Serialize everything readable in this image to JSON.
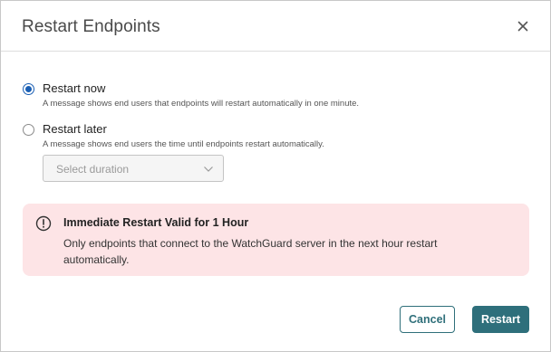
{
  "dialog": {
    "title": "Restart Endpoints",
    "close_icon": "close-icon"
  },
  "options": [
    {
      "label": "Restart now",
      "description": "A message shows end users that endpoints will restart automatically in one minute.",
      "checked": true
    },
    {
      "label": "Restart later",
      "description": "A message shows end users the time until endpoints restart automatically.",
      "checked": false
    }
  ],
  "duration_select": {
    "placeholder": "Select duration",
    "icon": "chevron-down-icon",
    "disabled": true
  },
  "alert": {
    "icon": "warning-circle-icon",
    "title": "Immediate Restart Valid for 1 Hour",
    "body": "Only endpoints that connect to the WatchGuard server in the next hour restart automatically.",
    "background": "#fde4e6"
  },
  "buttons": {
    "cancel_label": "Cancel",
    "restart_label": "Restart"
  },
  "colors": {
    "accent": "#2e6f7b",
    "radio_selected": "#1a5fb4"
  }
}
